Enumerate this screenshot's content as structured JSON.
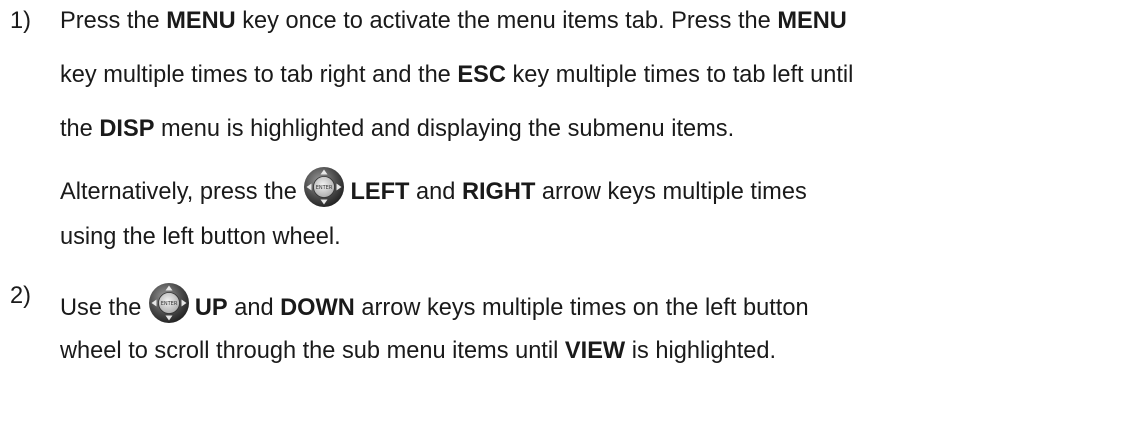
{
  "step1": {
    "number": "1)",
    "l1": {
      "a": "Press the ",
      "b": "MENU",
      "c": " key once to activate the menu items tab.  Press the ",
      "d": "MENU"
    },
    "l2": {
      "a": "key multiple times to tab right and the ",
      "b": "ESC",
      "c": " key multiple times to tab left until"
    },
    "l3": {
      "a": "the ",
      "b": "DISP",
      "c": " menu is highlighted and displaying the submenu items."
    },
    "l4": {
      "a": "Alternatively, press the ",
      "icon": "button-wheel-icon",
      "b": "LEFT",
      "c": " and ",
      "d": "RIGHT",
      "e": " arrow keys multiple times"
    },
    "l5": {
      "a": "using the left button wheel."
    }
  },
  "step2": {
    "number": "2)",
    "l1": {
      "a": "Use the ",
      "icon": "button-wheel-icon",
      "b": "UP",
      "c": " and ",
      "d": "DOWN",
      "e": " arrow keys multiple times on the left button"
    },
    "l2": {
      "a": "wheel to scroll through the sub menu items until ",
      "b": "VIEW",
      "c": " is highlighted."
    }
  },
  "colors": {
    "text": "#1a1a1a",
    "wheel_dark": "#2b2b2b",
    "wheel_light": "#bdbdbd"
  }
}
